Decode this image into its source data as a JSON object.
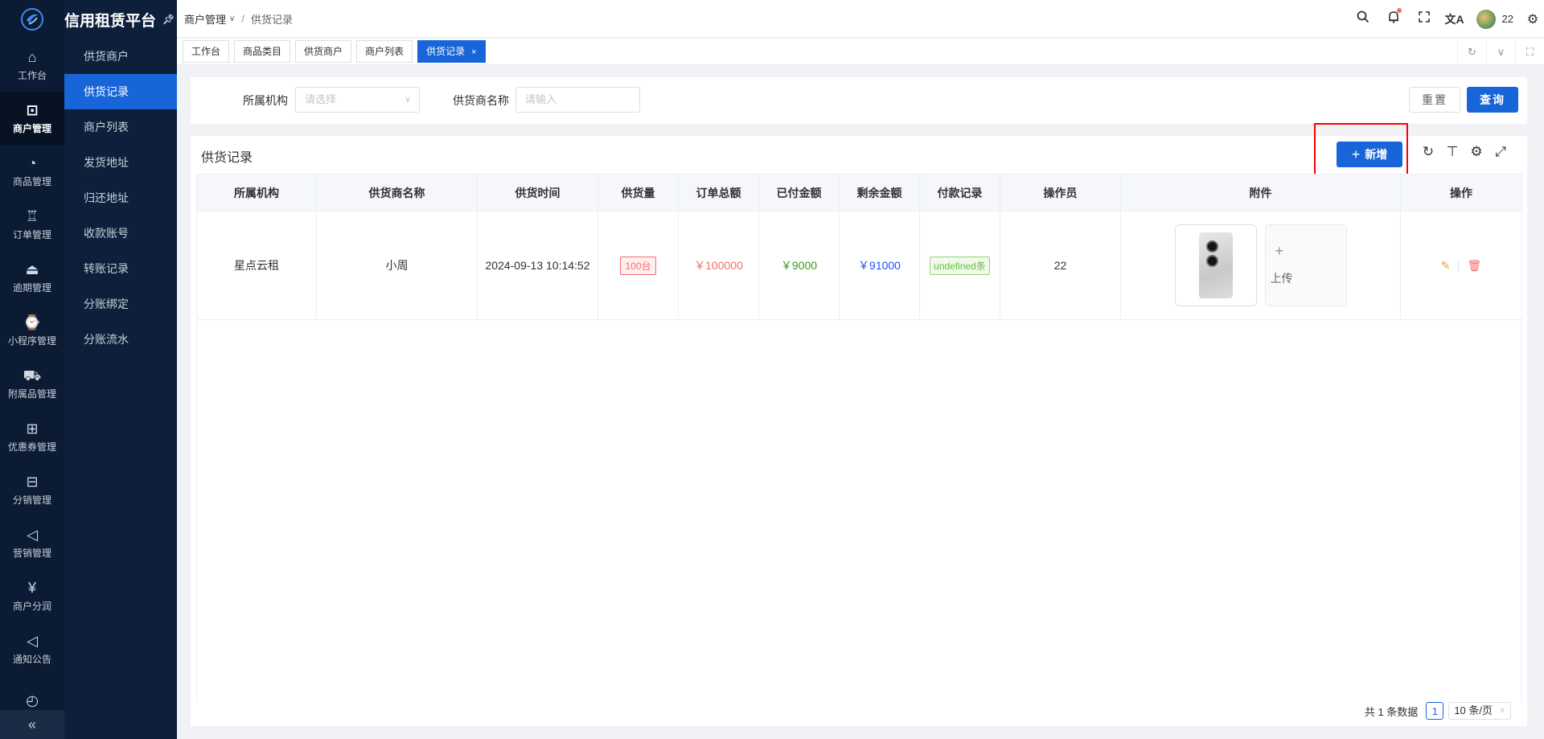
{
  "app": {
    "title": "信用租赁平台"
  },
  "rail": [
    {
      "icon": "home-icon",
      "glyph": "⌂",
      "label": "工作台"
    },
    {
      "icon": "shopping-bag-icon",
      "glyph": "⊡",
      "label": "商户管理",
      "active": true
    },
    {
      "icon": "apple-icon",
      "glyph": "◔",
      "label": "商品管理"
    },
    {
      "icon": "trophy-icon",
      "glyph": "♖",
      "label": "订单管理"
    },
    {
      "icon": "alarm-icon",
      "glyph": "⏏",
      "label": "逾期管理"
    },
    {
      "icon": "watch-icon",
      "glyph": "⌚",
      "label": "小程序管理"
    },
    {
      "icon": "cart-icon",
      "glyph": "⛟",
      "label": "附属品管理"
    },
    {
      "icon": "gift-icon",
      "glyph": "⊞",
      "label": "优惠券管理"
    },
    {
      "icon": "sliders-icon",
      "glyph": "⊟",
      "label": "分销管理"
    },
    {
      "icon": "megaphone-icon",
      "glyph": "◁",
      "label": "营销管理"
    },
    {
      "icon": "yen-icon",
      "glyph": "¥",
      "label": "商户分润"
    },
    {
      "icon": "notice-icon",
      "glyph": "◁",
      "label": "通知公告"
    },
    {
      "icon": "clock-icon",
      "glyph": "◴",
      "label": ""
    }
  ],
  "submenu": [
    {
      "label": "供货商户"
    },
    {
      "label": "供货记录",
      "active": true
    },
    {
      "label": "商户列表"
    },
    {
      "label": "发货地址"
    },
    {
      "label": "归还地址"
    },
    {
      "label": "收款账号"
    },
    {
      "label": "转账记录"
    },
    {
      "label": "分账绑定"
    },
    {
      "label": "分账流水"
    }
  ],
  "breadcrumb": {
    "parent": "商户管理",
    "current": "供货记录"
  },
  "header": {
    "username": "22"
  },
  "tabs": [
    {
      "label": "工作台"
    },
    {
      "label": "商品类目"
    },
    {
      "label": "供货商户"
    },
    {
      "label": "商户列表"
    },
    {
      "label": "供货记录",
      "active": true
    }
  ],
  "search": {
    "org_label": "所属机构",
    "org_placeholder": "请选择",
    "name_label": "供货商名称",
    "name_placeholder": "请输入",
    "reset_label": "重置",
    "query_label": "查询"
  },
  "panel": {
    "title": "供货记录",
    "add_label": "新增"
  },
  "table": {
    "columns": [
      "所属机构",
      "供货商名称",
      "供货时间",
      "供货量",
      "订单总额",
      "已付金额",
      "剩余金额",
      "付款记录",
      "操作员",
      "附件",
      "操作"
    ],
    "rows": [
      {
        "org": "星点云租",
        "supplier": "小周",
        "time": "2024-09-13 10:14:52",
        "qty": "100台",
        "total": "￥100000",
        "paid": "￥9000",
        "remaining": "￥91000",
        "payments": "undefined条",
        "operator": "22",
        "upload_label": "上传"
      }
    ]
  },
  "pagination": {
    "summary": "共 1 条数据",
    "page": "1",
    "page_size": "10 条/页"
  },
  "colors": {
    "primary": "#1765d8",
    "sidebar": "#0b1b33",
    "danger": "#f56c6c",
    "success": "#3a9a1a",
    "info_blue": "#1f4fff",
    "highlight": "#ff0000"
  }
}
